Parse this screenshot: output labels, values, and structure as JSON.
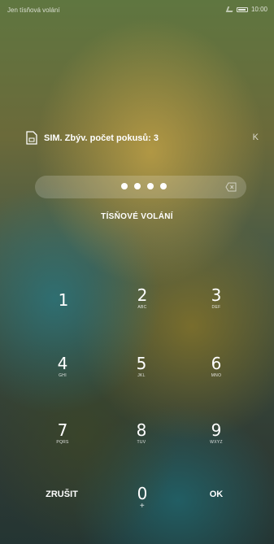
{
  "status": {
    "left_text": "Jen tísňová volání",
    "time": "10:00"
  },
  "sim": {
    "text": "SIM. Zbýv. počet pokusů: 3",
    "right_glyph": "K"
  },
  "pin": {
    "masked": "●●●●",
    "entered_length": 4
  },
  "emergency_label": "TÍSŇOVÉ VOLÁNÍ",
  "keypad": {
    "k1": {
      "digit": "1",
      "letters": ""
    },
    "k2": {
      "digit": "2",
      "letters": "ABC"
    },
    "k3": {
      "digit": "3",
      "letters": "DEF"
    },
    "k4": {
      "digit": "4",
      "letters": "GHI"
    },
    "k5": {
      "digit": "5",
      "letters": "JKL"
    },
    "k6": {
      "digit": "6",
      "letters": "MNO"
    },
    "k7": {
      "digit": "7",
      "letters": "PQRS"
    },
    "k8": {
      "digit": "8",
      "letters": "TUV"
    },
    "k9": {
      "digit": "9",
      "letters": "WXYZ"
    },
    "k0": {
      "digit": "0",
      "letters": "+"
    },
    "cancel": "ZRUŠIT",
    "ok": "OK"
  },
  "icons": {
    "sim": "sim-card-icon",
    "backspace": "backspace-icon",
    "signal": "signal-icon",
    "battery": "battery-icon"
  }
}
